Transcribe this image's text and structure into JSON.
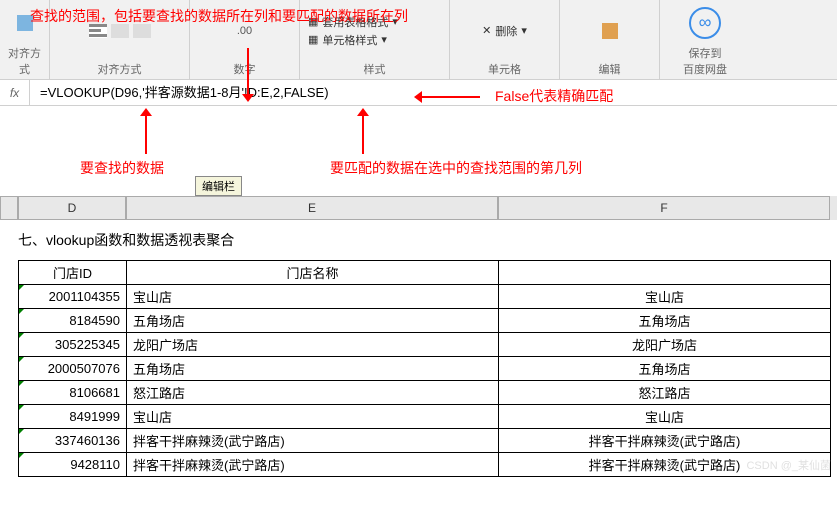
{
  "ribbon": {
    "groups": [
      "对齐方式",
      "数字",
      "样式",
      "单元格",
      "编辑"
    ],
    "style_items": [
      "套用表格格式",
      "单元格样式"
    ],
    "cell_items": [
      "删除"
    ],
    "baidu": "保存到\n百度网盘"
  },
  "formula": "=VLOOKUP(D96,'拌客源数据1-8月'!D:E,2,FALSE)",
  "annotations": {
    "range": "查找的范围，包括要查找的数据所在列和要匹配的数据所在列",
    "lookup": "要查找的数据",
    "col": "要匹配的数据在选中的查找范围的第几列",
    "false_t": "False代表精确匹配"
  },
  "tooltip": "编辑栏",
  "sheet": {
    "columns": [
      "D",
      "E",
      "F"
    ],
    "title": "七、vlookup函数和数据透视表聚合",
    "headers": [
      "门店ID",
      "门店名称"
    ],
    "rows": [
      {
        "id": "2001104355",
        "name": "宝山店",
        "f": "宝山店"
      },
      {
        "id": "8184590",
        "name": "五角场店",
        "f": "五角场店"
      },
      {
        "id": "305225345",
        "name": "龙阳广场店",
        "f": "龙阳广场店"
      },
      {
        "id": "2000507076",
        "name": "五角场店",
        "f": "五角场店"
      },
      {
        "id": "8106681",
        "name": "怒江路店",
        "f": "怒江路店"
      },
      {
        "id": "8491999",
        "name": "宝山店",
        "f": "宝山店"
      },
      {
        "id": "337460136",
        "name": "拌客干拌麻辣烫(武宁路店)",
        "f": "拌客干拌麻辣烫(武宁路店)"
      },
      {
        "id": "9428110",
        "name": "拌客干拌麻辣烫(武宁路店)",
        "f": "拌客干拌麻辣烫(武宁路店)"
      }
    ]
  },
  "chart_data": {
    "type": "table",
    "title": "七、vlookup函数和数据透视表聚合",
    "columns": [
      "门店ID",
      "门店名称",
      "F"
    ],
    "rows": [
      [
        "2001104355",
        "宝山店",
        "宝山店"
      ],
      [
        "8184590",
        "五角场店",
        "五角场店"
      ],
      [
        "305225345",
        "龙阳广场店",
        "龙阳广场店"
      ],
      [
        "2000507076",
        "五角场店",
        "五角场店"
      ],
      [
        "8106681",
        "怒江路店",
        "怒江路店"
      ],
      [
        "8491999",
        "宝山店",
        "宝山店"
      ],
      [
        "337460136",
        "拌客干拌麻辣烫(武宁路店)",
        "拌客干拌麻辣烫(武宁路店)"
      ],
      [
        "9428110",
        "拌客干拌麻辣烫(武宁路店)",
        "拌客干拌麻辣烫(武宁路店)"
      ]
    ]
  },
  "watermark": "CSDN @_某仙菌"
}
